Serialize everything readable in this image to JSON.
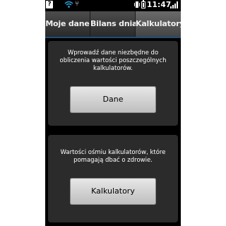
{
  "statusbar": {
    "help_glyph": "?",
    "usb_glyph": "⑂",
    "time": "11:47",
    "icons": [
      "help-icon",
      "wifi-icon",
      "usb-icon",
      "vibrate-icon",
      "battery-icon",
      "signal-icon"
    ]
  },
  "tabs": [
    {
      "label": "Moje dane",
      "selected": false
    },
    {
      "label": "Bilans dnia",
      "selected": false
    },
    {
      "label": "Kalkulatory",
      "selected": true
    }
  ],
  "cards": [
    {
      "text": "Wprowadź dane niezbędne do obliczenia wartości poszczególnych kalkulatorów.",
      "button_label": "Dane"
    },
    {
      "text": "Wartości ośmiu kalkulatorów, które pomagają dbać o zdrowie.",
      "button_label": "Kalkulatory"
    }
  ],
  "colors": {
    "screen_bg": "#000000",
    "card_bg": "#2b2b2b",
    "tab_bg": "#3a3a3a",
    "button_bg": "#d8d8d8",
    "accent": "#1e4f79"
  }
}
